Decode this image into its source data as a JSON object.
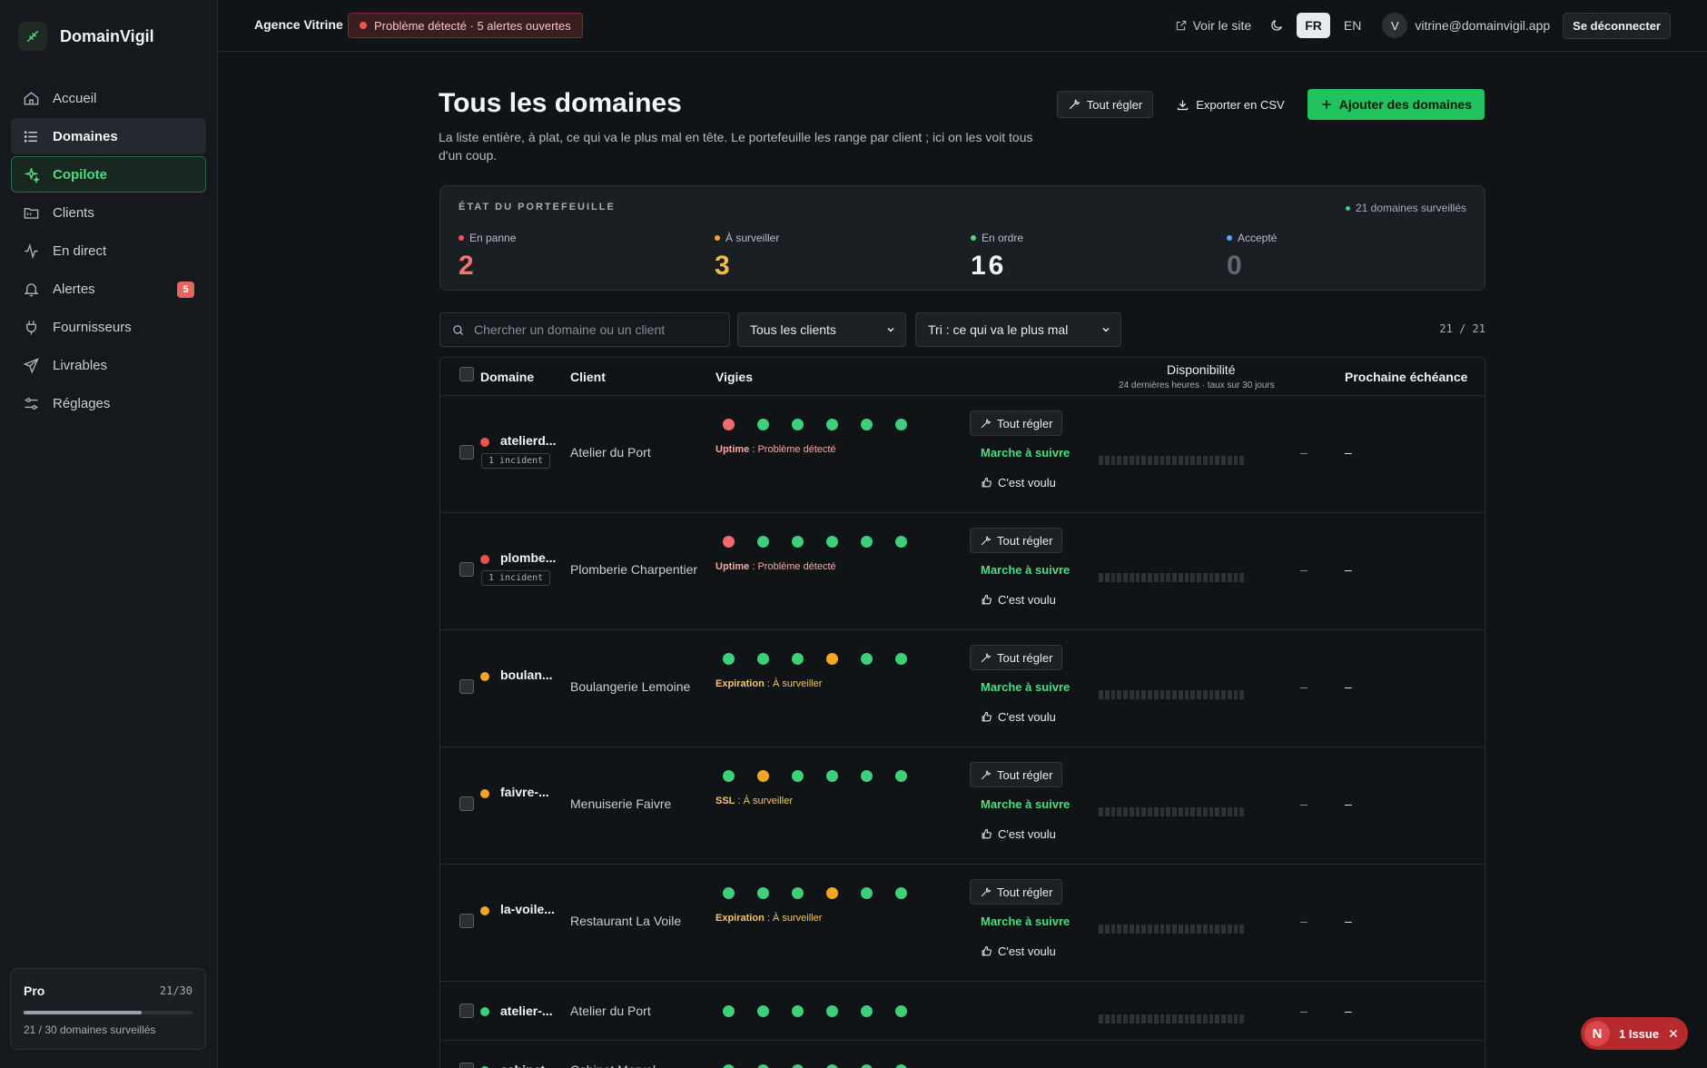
{
  "brand": {
    "name": "DomainVigil"
  },
  "sidebar": {
    "items": [
      {
        "label": "Accueil",
        "icon": "home-icon"
      },
      {
        "label": "Domaines",
        "icon": "list-icon"
      },
      {
        "label": "Copilote",
        "icon": "sparkle-icon"
      },
      {
        "label": "Clients",
        "icon": "folder-icon"
      },
      {
        "label": "En direct",
        "icon": "activity-icon"
      },
      {
        "label": "Alertes",
        "icon": "bell-icon",
        "badge": "5"
      },
      {
        "label": "Fournisseurs",
        "icon": "plug-icon"
      },
      {
        "label": "Livrables",
        "icon": "send-icon"
      },
      {
        "label": "Réglages",
        "icon": "sliders-icon"
      }
    ],
    "plan": {
      "name": "Pro",
      "count": "21/30",
      "used": 21,
      "limit": 30,
      "footer": "21 / 30 domaines surveillés"
    }
  },
  "topbar": {
    "agency": "Agence Vitrine",
    "alert": "Problème détecté · 5 alertes ouvertes",
    "view_site": "Voir le site",
    "lang_fr": "FR",
    "lang_en": "EN",
    "avatar": "V",
    "email": "vitrine@domainvigil.app",
    "logout": "Se déconnecter"
  },
  "header": {
    "title": "Tous les domaines",
    "description": "La liste entière, à plat, ce qui va le plus mal en tête. Le portefeuille les range par client ; ici on les voit tous d'un coup.",
    "fix_all": "Tout régler",
    "export": "Exporter en CSV",
    "add": "Ajouter des domaines"
  },
  "portfolio": {
    "label": "ÉTAT DU PORTEFEUILLE",
    "monitored": "21 domaines surveillés",
    "stats": [
      {
        "label": "En panne",
        "value": "2",
        "color": "#f0766f"
      },
      {
        "label": "À surveiller",
        "value": "3",
        "color": "#f5b94a"
      },
      {
        "label": "En ordre",
        "value": "16",
        "color": "#f1f3f4",
        "dot": "#4ade80"
      },
      {
        "label": "Accepté",
        "value": "0",
        "color": "#5f676f",
        "dot": "#60a5fa"
      }
    ]
  },
  "filters": {
    "search_placeholder": "Chercher un domaine ou un client",
    "client_select": "Tous les clients",
    "sort_select": "Tri : ce qui va le plus mal",
    "count": "21  /  21"
  },
  "table": {
    "headers": {
      "domain": "Domaine",
      "client": "Client",
      "vigies": "Vigies",
      "availability": "Disponibilité",
      "availability_sub": "24 dernières heures · taux sur 30 jours",
      "deadline": "Prochaine échéance"
    },
    "row_fix": "Tout régler",
    "row_follow": "Marche à suivre",
    "row_intended": "C'est voulu",
    "dash": "–",
    "rows": [
      {
        "domain": "atelierd...",
        "client": "Atelier du Port",
        "status": "#ef5350",
        "incident": "1 incident",
        "vigies": [
          "#f06b6b",
          "#3ecf7a",
          "#3ecf7a",
          "#3ecf7a",
          "#3ecf7a",
          "#3ecf7a"
        ],
        "note_key": "Uptime",
        "note_val": "Problème détecté",
        "note_color": "#f5a9a3"
      },
      {
        "domain": "plombe...",
        "client": "Plomberie Charpentier",
        "status": "#ef5350",
        "incident": "1 incident",
        "vigies": [
          "#f06b6b",
          "#3ecf7a",
          "#3ecf7a",
          "#3ecf7a",
          "#3ecf7a",
          "#3ecf7a"
        ],
        "note_key": "Uptime",
        "note_val": "Problème détecté",
        "note_color": "#f5a9a3"
      },
      {
        "domain": "boulan...",
        "client": "Boulangerie Lemoine",
        "status": "#f5a623",
        "vigies": [
          "#3ecf7a",
          "#3ecf7a",
          "#3ecf7a",
          "#f5a623",
          "#3ecf7a",
          "#3ecf7a"
        ],
        "note_key": "Expiration",
        "note_val": "À surveiller",
        "note_color": "#f5c46a"
      },
      {
        "domain": "faivre-...",
        "client": "Menuiserie Faivre",
        "status": "#f5a623",
        "vigies": [
          "#3ecf7a",
          "#f5a623",
          "#3ecf7a",
          "#3ecf7a",
          "#3ecf7a",
          "#3ecf7a"
        ],
        "note_key": "SSL",
        "note_val": "À surveiller",
        "note_color": "#f5c46a"
      },
      {
        "domain": "la-voile...",
        "client": "Restaurant La Voile",
        "status": "#f5a623",
        "vigies": [
          "#3ecf7a",
          "#3ecf7a",
          "#3ecf7a",
          "#f5a623",
          "#3ecf7a",
          "#3ecf7a"
        ],
        "note_key": "Expiration",
        "note_val": "À surveiller",
        "note_color": "#f5c46a"
      },
      {
        "domain": "atelier-...",
        "client": "Atelier du Port",
        "status": "#3ecf7a",
        "vigies": [
          "#3ecf7a",
          "#3ecf7a",
          "#3ecf7a",
          "#3ecf7a",
          "#3ecf7a",
          "#3ecf7a"
        ]
      },
      {
        "domain": "cabinet...",
        "client": "Cabinet Morvel",
        "status": "#3ecf7a",
        "vigies": [
          "#3ecf7a",
          "#3ecf7a",
          "#3ecf7a",
          "#3ecf7a",
          "#3ecf7a",
          "#3ecf7a"
        ]
      }
    ]
  },
  "toast": {
    "letter": "N",
    "label": "1 Issue"
  }
}
